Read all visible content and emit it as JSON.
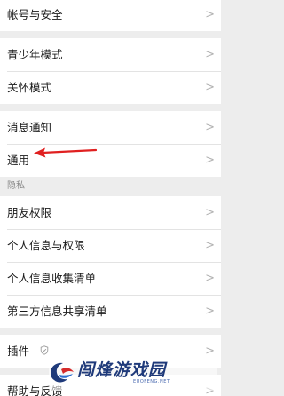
{
  "chevron": ">",
  "groups": [
    {
      "items": [
        {
          "label": "帐号与安全"
        }
      ]
    },
    {
      "items": [
        {
          "label": "青少年模式"
        },
        {
          "label": "关怀模式"
        }
      ]
    },
    {
      "items": [
        {
          "label": "消息通知"
        },
        {
          "label": "通用"
        }
      ]
    },
    {
      "section_label": "隐私",
      "items": [
        {
          "label": "朋友权限"
        },
        {
          "label": "个人信息与权限"
        },
        {
          "label": "个人信息收集清单"
        },
        {
          "label": "第三方信息共享清单"
        }
      ]
    },
    {
      "items": [
        {
          "label": "插件",
          "badge_icon": "plugin-shield-icon"
        }
      ]
    },
    {
      "items": [
        {
          "label": "帮助与反馈"
        }
      ]
    }
  ],
  "annotation": {
    "color": "#e02020",
    "icon": "red-arrow-pointing-left"
  },
  "watermark": {
    "text": "闯烽游戏园",
    "subtext": "EUOFENG.NET",
    "color": "#1f3a7a"
  }
}
